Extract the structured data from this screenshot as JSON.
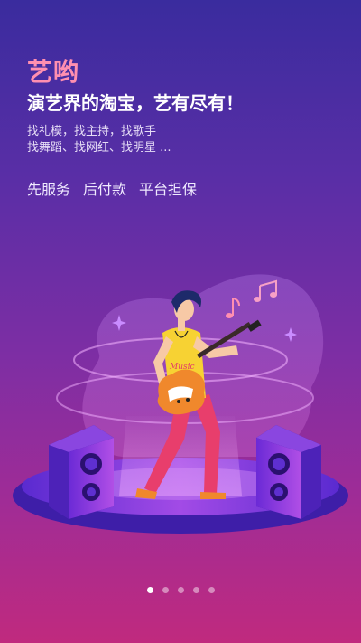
{
  "brand": {
    "logo_text": "艺哟"
  },
  "hero": {
    "tagline": "演艺界的淘宝，艺有尽有！",
    "description_lines": [
      "找礼模，找主持，找歌手",
      "找舞蹈、找网红、找明星 ..."
    ],
    "features": [
      "先服务",
      "后付款",
      "平台担保"
    ]
  },
  "illustration": {
    "shirt_text": "Music",
    "icons": [
      "music-note-icon",
      "double-music-note-icon",
      "sparkle-icon",
      "speaker-icon",
      "electric-guitar-icon"
    ]
  },
  "pagination": {
    "total": 5,
    "active_index": 0
  },
  "colors": {
    "logo": "#ff8fb0",
    "background_top": "#3a2c9e",
    "background_bottom": "#c02a7e",
    "shirt": "#f7d233",
    "pants": "#e83e6c",
    "guitar": "#f0882c"
  }
}
